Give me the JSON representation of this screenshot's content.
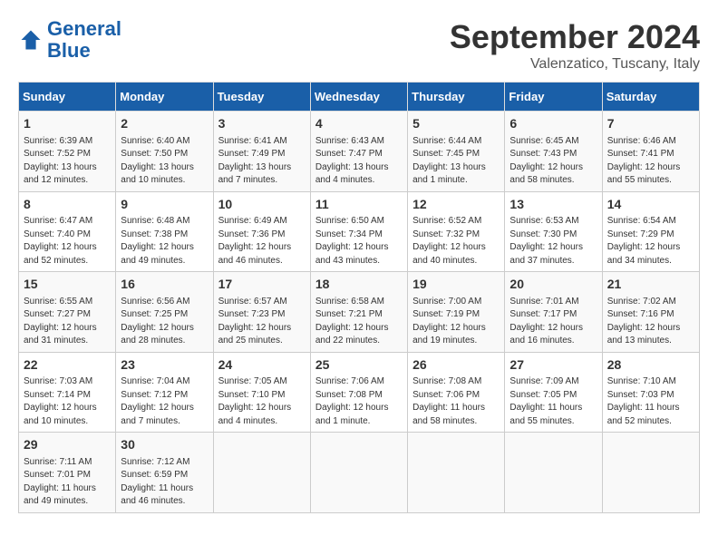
{
  "logo": {
    "text1": "General",
    "text2": "Blue"
  },
  "title": "September 2024",
  "subtitle": "Valenzatico, Tuscany, Italy",
  "headers": [
    "Sunday",
    "Monday",
    "Tuesday",
    "Wednesday",
    "Thursday",
    "Friday",
    "Saturday"
  ],
  "weeks": [
    [
      {
        "day": "1",
        "info": "Sunrise: 6:39 AM\nSunset: 7:52 PM\nDaylight: 13 hours\nand 12 minutes."
      },
      {
        "day": "2",
        "info": "Sunrise: 6:40 AM\nSunset: 7:50 PM\nDaylight: 13 hours\nand 10 minutes."
      },
      {
        "day": "3",
        "info": "Sunrise: 6:41 AM\nSunset: 7:49 PM\nDaylight: 13 hours\nand 7 minutes."
      },
      {
        "day": "4",
        "info": "Sunrise: 6:43 AM\nSunset: 7:47 PM\nDaylight: 13 hours\nand 4 minutes."
      },
      {
        "day": "5",
        "info": "Sunrise: 6:44 AM\nSunset: 7:45 PM\nDaylight: 13 hours\nand 1 minute."
      },
      {
        "day": "6",
        "info": "Sunrise: 6:45 AM\nSunset: 7:43 PM\nDaylight: 12 hours\nand 58 minutes."
      },
      {
        "day": "7",
        "info": "Sunrise: 6:46 AM\nSunset: 7:41 PM\nDaylight: 12 hours\nand 55 minutes."
      }
    ],
    [
      {
        "day": "8",
        "info": "Sunrise: 6:47 AM\nSunset: 7:40 PM\nDaylight: 12 hours\nand 52 minutes."
      },
      {
        "day": "9",
        "info": "Sunrise: 6:48 AM\nSunset: 7:38 PM\nDaylight: 12 hours\nand 49 minutes."
      },
      {
        "day": "10",
        "info": "Sunrise: 6:49 AM\nSunset: 7:36 PM\nDaylight: 12 hours\nand 46 minutes."
      },
      {
        "day": "11",
        "info": "Sunrise: 6:50 AM\nSunset: 7:34 PM\nDaylight: 12 hours\nand 43 minutes."
      },
      {
        "day": "12",
        "info": "Sunrise: 6:52 AM\nSunset: 7:32 PM\nDaylight: 12 hours\nand 40 minutes."
      },
      {
        "day": "13",
        "info": "Sunrise: 6:53 AM\nSunset: 7:30 PM\nDaylight: 12 hours\nand 37 minutes."
      },
      {
        "day": "14",
        "info": "Sunrise: 6:54 AM\nSunset: 7:29 PM\nDaylight: 12 hours\nand 34 minutes."
      }
    ],
    [
      {
        "day": "15",
        "info": "Sunrise: 6:55 AM\nSunset: 7:27 PM\nDaylight: 12 hours\nand 31 minutes."
      },
      {
        "day": "16",
        "info": "Sunrise: 6:56 AM\nSunset: 7:25 PM\nDaylight: 12 hours\nand 28 minutes."
      },
      {
        "day": "17",
        "info": "Sunrise: 6:57 AM\nSunset: 7:23 PM\nDaylight: 12 hours\nand 25 minutes."
      },
      {
        "day": "18",
        "info": "Sunrise: 6:58 AM\nSunset: 7:21 PM\nDaylight: 12 hours\nand 22 minutes."
      },
      {
        "day": "19",
        "info": "Sunrise: 7:00 AM\nSunset: 7:19 PM\nDaylight: 12 hours\nand 19 minutes."
      },
      {
        "day": "20",
        "info": "Sunrise: 7:01 AM\nSunset: 7:17 PM\nDaylight: 12 hours\nand 16 minutes."
      },
      {
        "day": "21",
        "info": "Sunrise: 7:02 AM\nSunset: 7:16 PM\nDaylight: 12 hours\nand 13 minutes."
      }
    ],
    [
      {
        "day": "22",
        "info": "Sunrise: 7:03 AM\nSunset: 7:14 PM\nDaylight: 12 hours\nand 10 minutes."
      },
      {
        "day": "23",
        "info": "Sunrise: 7:04 AM\nSunset: 7:12 PM\nDaylight: 12 hours\nand 7 minutes."
      },
      {
        "day": "24",
        "info": "Sunrise: 7:05 AM\nSunset: 7:10 PM\nDaylight: 12 hours\nand 4 minutes."
      },
      {
        "day": "25",
        "info": "Sunrise: 7:06 AM\nSunset: 7:08 PM\nDaylight: 12 hours\nand 1 minute."
      },
      {
        "day": "26",
        "info": "Sunrise: 7:08 AM\nSunset: 7:06 PM\nDaylight: 11 hours\nand 58 minutes."
      },
      {
        "day": "27",
        "info": "Sunrise: 7:09 AM\nSunset: 7:05 PM\nDaylight: 11 hours\nand 55 minutes."
      },
      {
        "day": "28",
        "info": "Sunrise: 7:10 AM\nSunset: 7:03 PM\nDaylight: 11 hours\nand 52 minutes."
      }
    ],
    [
      {
        "day": "29",
        "info": "Sunrise: 7:11 AM\nSunset: 7:01 PM\nDaylight: 11 hours\nand 49 minutes."
      },
      {
        "day": "30",
        "info": "Sunrise: 7:12 AM\nSunset: 6:59 PM\nDaylight: 11 hours\nand 46 minutes."
      },
      {
        "day": "",
        "info": ""
      },
      {
        "day": "",
        "info": ""
      },
      {
        "day": "",
        "info": ""
      },
      {
        "day": "",
        "info": ""
      },
      {
        "day": "",
        "info": ""
      }
    ]
  ]
}
